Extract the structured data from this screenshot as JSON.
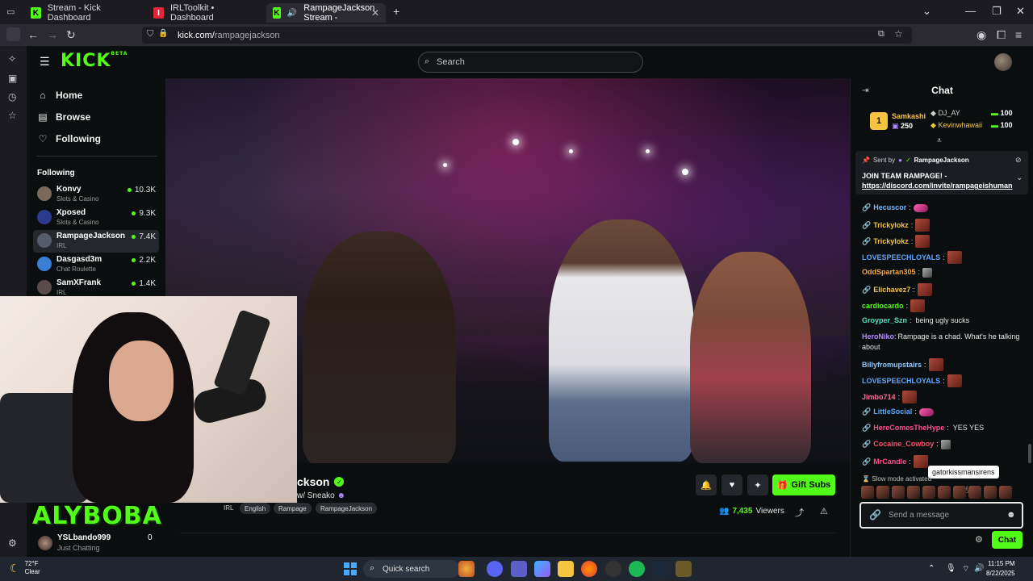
{
  "browser": {
    "tabs": [
      {
        "label": "Stream - Kick Dashboard",
        "favicon": "K"
      },
      {
        "label": "IRLToolkit • Dashboard",
        "favicon": "I"
      },
      {
        "label": "RampageJackson Stream -",
        "favicon": "K",
        "active": true
      }
    ],
    "new_tab_icon": "+",
    "url_host": "kick.com/",
    "url_path": "rampagejackson"
  },
  "kick": {
    "logo": "KICK",
    "logo_sup": "BETA",
    "search_placeholder": "Search",
    "nav": [
      {
        "label": "Home",
        "icon": "home-icon",
        "glyph": "⌂"
      },
      {
        "label": "Browse",
        "icon": "browse-icon",
        "glyph": "▤"
      },
      {
        "label": "Following",
        "icon": "heart-icon",
        "glyph": "♡"
      }
    ],
    "following_heading": "Following",
    "following": [
      {
        "name": "Konvy",
        "category": "Slots & Casino",
        "viewers": "10.3K",
        "color": "#7a6a5a"
      },
      {
        "name": "Xposed",
        "category": "Slots & Casino",
        "viewers": "9.3K",
        "color": "#2b3a8c"
      },
      {
        "name": "RampageJackson",
        "category": "IRL",
        "viewers": "7.4K",
        "color": "#555c6a",
        "selected": true
      },
      {
        "name": "Dasgasd3m",
        "category": "Chat Roulette",
        "viewers": "2.2K",
        "color": "#3a7fd4"
      },
      {
        "name": "SamXFrank",
        "category": "IRL",
        "viewers": "1.4K",
        "color": "#5a4a4a"
      }
    ]
  },
  "stream": {
    "title": "ckson",
    "subtitle": "w/ Sneako",
    "category": "IRL",
    "tags": [
      "English",
      "Rampage",
      "RampageJackson"
    ],
    "gift_subs_label": "Gift Subs",
    "viewer_count": "7,435",
    "viewers_label": "Viewers",
    "overlay_text": "ALYBOBA"
  },
  "live_card": {
    "name": "YSLbando999",
    "category": "Just Chatting",
    "trailing": "0"
  },
  "chat": {
    "title": "Chat",
    "leaderboard": {
      "rank": "1",
      "first": {
        "name": "Samkashi",
        "amount": "250"
      },
      "second": {
        "name": "DJ_AY",
        "amount": "100"
      },
      "third": {
        "name": "Kevinwhawaii",
        "amount": "100"
      }
    },
    "pinned": {
      "sent_by_label": "Sent by",
      "sender": "RampageJackson",
      "message": "JOIN TEAM RAMPAGE! -",
      "link": "https://discord.com/invite/rampageishuman"
    },
    "messages": [
      {
        "user": "Hecuscor",
        "color": "#7ab8ff",
        "text": "",
        "emote": "pink"
      },
      {
        "user": "Trickylokz",
        "color": "#f5c542",
        "text": "",
        "emote": "face"
      },
      {
        "user": "Trickylokz",
        "color": "#f5c542",
        "text": "",
        "emote": "face"
      },
      {
        "user": "LOVESPEECHLOYALS",
        "color": "#5aa8ff",
        "text": "",
        "emote": "face"
      },
      {
        "user": "OddSpartan305",
        "color": "#f5a742",
        "text": "",
        "emote": "sm"
      },
      {
        "user": "Elichavez7",
        "color": "#f5c542",
        "text": "",
        "emote": "face"
      },
      {
        "user": "cardiocardo",
        "color": "#53fc18",
        "text": "",
        "emote": "face"
      },
      {
        "user": "Groyper_Szn",
        "color": "#53e0c0",
        "text": "being ugly sucks",
        "emote": ""
      },
      {
        "user": "HeroNiko",
        "color": "#b48cff",
        "text": "Rampage is a chad. What's he talking about",
        "emote": ""
      },
      {
        "user": "Billyfromupstairs",
        "color": "#8ec8ff",
        "text": "",
        "emote": "face"
      },
      {
        "user": "LOVESPEECHLOYALS",
        "color": "#5aa8ff",
        "text": "",
        "emote": "face"
      },
      {
        "user": "Jimbo714",
        "color": "#ff6b9a",
        "text": "",
        "emote": "face"
      },
      {
        "user": "LittleSocial",
        "color": "#5aa8ff",
        "text": "",
        "emote": "pink"
      },
      {
        "user": "HereComesTheHype",
        "color": "#ff4f8b",
        "text": "YES YES",
        "emote": ""
      },
      {
        "user": "Cocaine_Cowboy",
        "color": "#ff4f6b",
        "text": "",
        "emote": "sm"
      },
      {
        "user": "MrCandle",
        "color": "#ff4f8b",
        "text": "",
        "emote": "face"
      }
    ],
    "tooltip": "gatorkissmansirens",
    "slow_mode": "Slow mode activated",
    "input_placeholder": "Send a message",
    "send_label": "Chat"
  },
  "taskbar": {
    "weather_temp": "72°F",
    "weather_desc": "Clear",
    "search_label": "Quick search",
    "time": "11:15 PM",
    "date": "8/22/2025"
  }
}
